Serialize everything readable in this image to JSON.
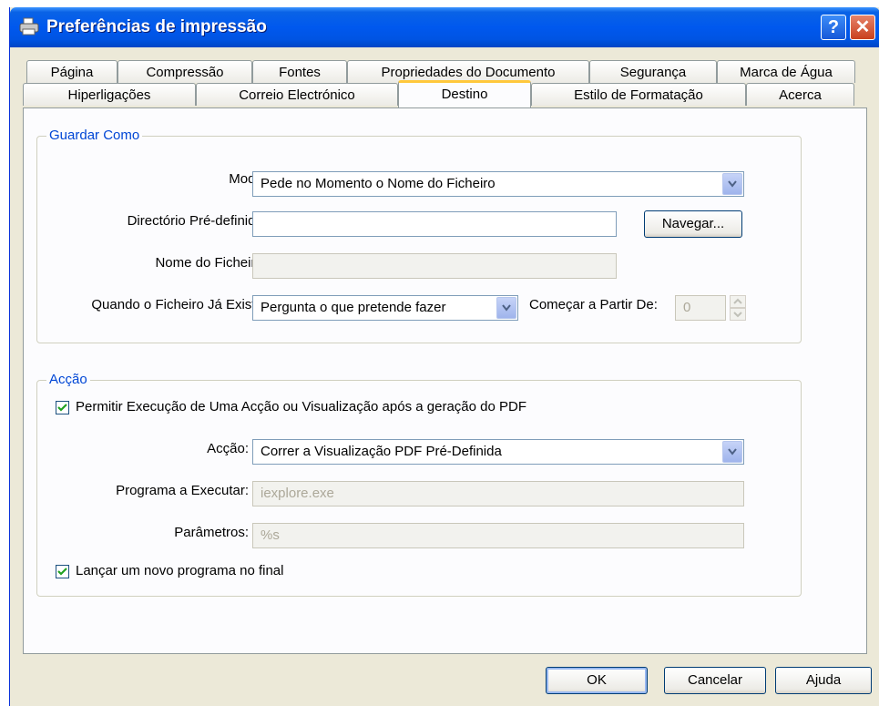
{
  "window": {
    "title": "Preferências de impressão",
    "help_glyph": "?",
    "close_glyph": "✕"
  },
  "tabs_row1": [
    {
      "label": "Página"
    },
    {
      "label": "Compressão"
    },
    {
      "label": "Fontes"
    },
    {
      "label": "Propriedades do Documento"
    },
    {
      "label": "Segurança"
    },
    {
      "label": "Marca de Água"
    }
  ],
  "tabs_row2": [
    {
      "label": "Hiperligações"
    },
    {
      "label": "Correio Electrónico"
    },
    {
      "label": "Destino"
    },
    {
      "label": "Estilo de Formatação"
    },
    {
      "label": "Acerca"
    }
  ],
  "save_as": {
    "group_title": "Guardar Como",
    "mode_label": "Modo:",
    "mode_value": "Pede no Momento o Nome do Ficheiro",
    "default_dir_label": "Directório Pré-definido:",
    "default_dir_value": "",
    "browse_label": "Navegar...",
    "filename_label": "Nome do Ficheiro:",
    "filename_value": "",
    "exists_label": "Quando o Ficheiro Já Existe:",
    "exists_value": "Pergunta o que pretende fazer",
    "start_from_label": "Começar a Partir De:",
    "start_from_value": "0"
  },
  "action": {
    "group_title": "Acção",
    "allow_label": "Permitir Execução de Uma Acção ou Visualização após a geração do PDF",
    "allow_checked": true,
    "action_label": "Acção:",
    "action_value": "Correr a Visualização PDF Pré-Definida",
    "program_label": "Programa a Executar:",
    "program_value": "iexplore.exe",
    "params_label": "Parâmetros:",
    "params_value": "%s",
    "launch_label": "Lançar um novo programa no final",
    "launch_checked": true
  },
  "buttons": {
    "ok": "OK",
    "cancel": "Cancelar",
    "help": "Ajuda"
  }
}
